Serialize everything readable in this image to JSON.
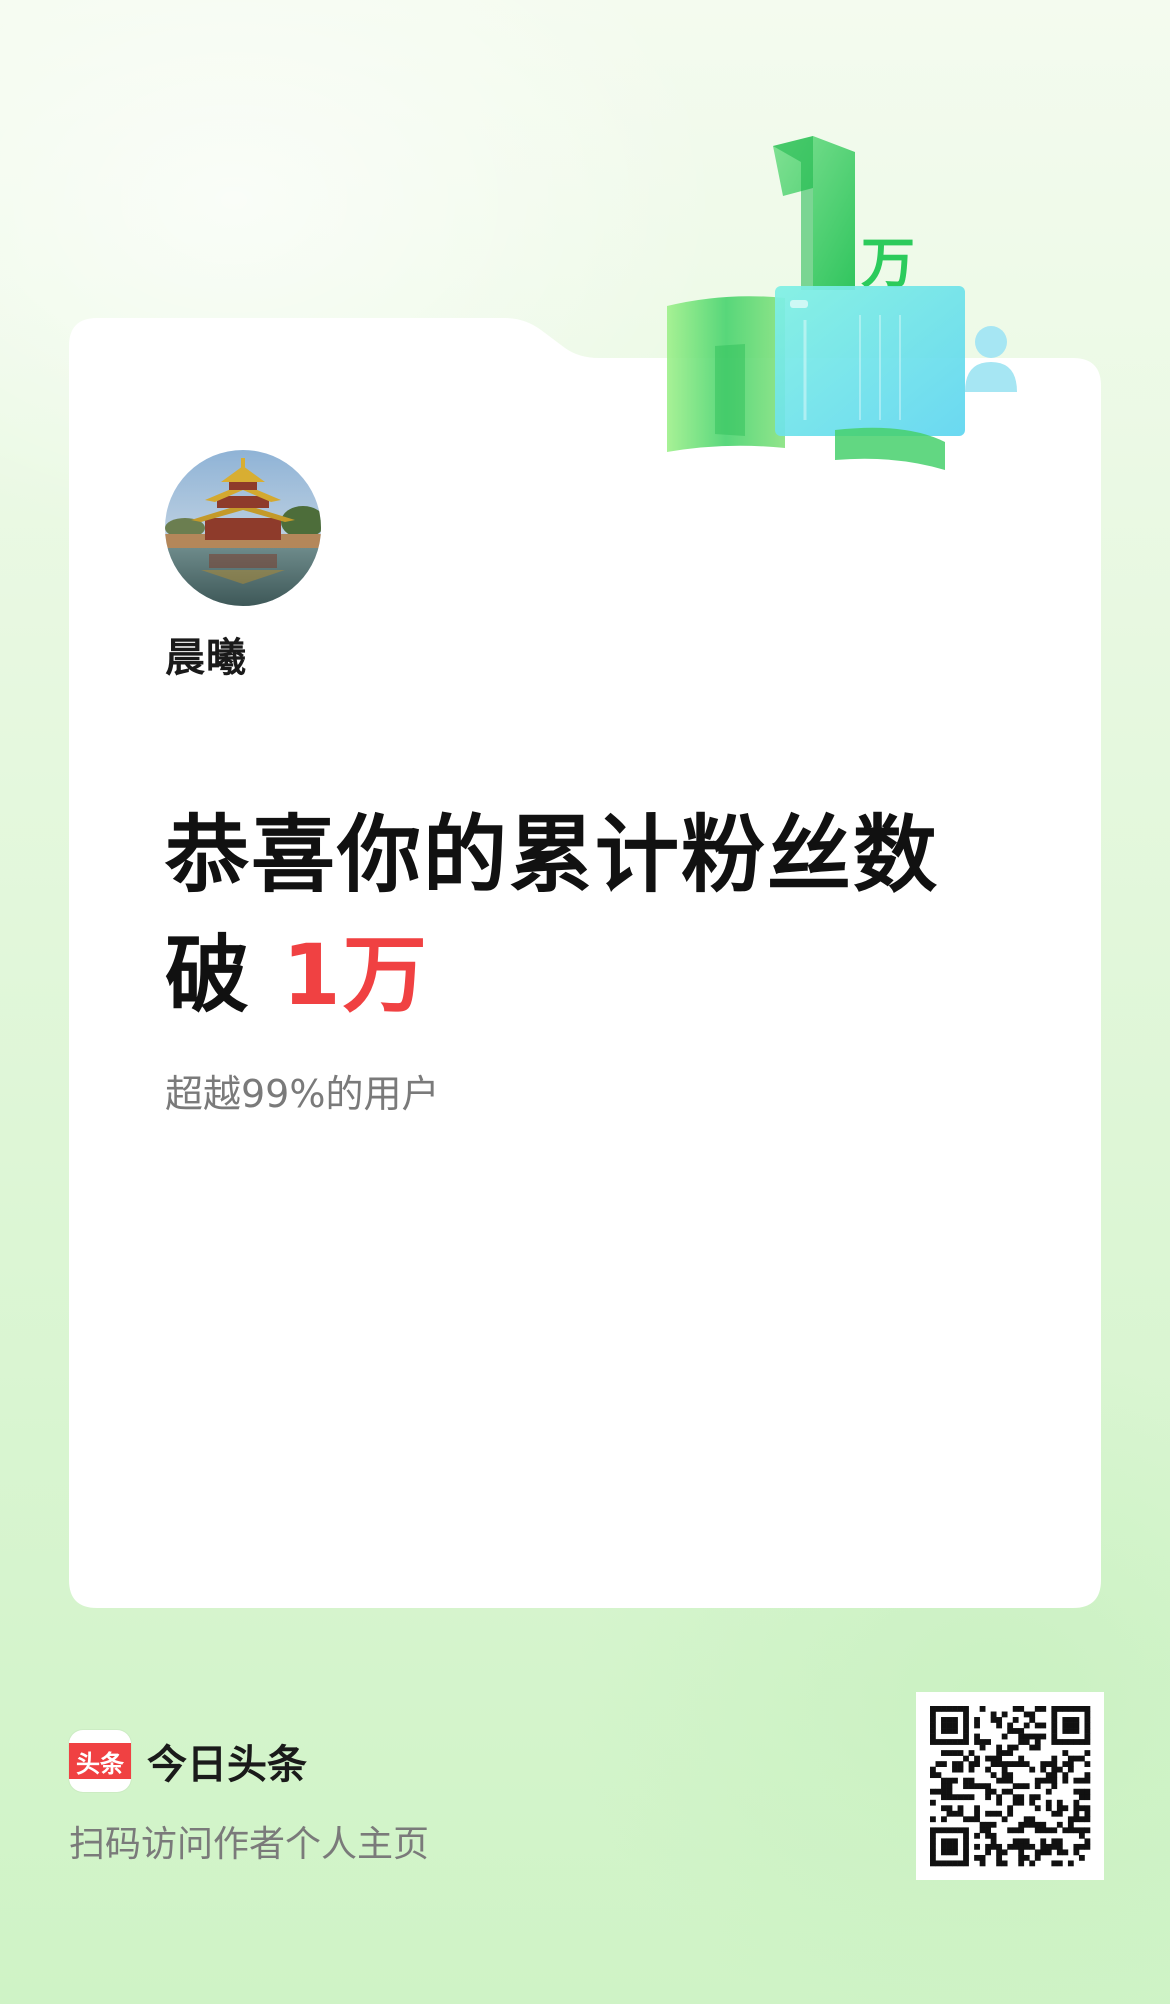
{
  "badge": {
    "number": "1",
    "unit": "万"
  },
  "profile": {
    "username": "晨曦",
    "avatar_icon": "forbidden-city-corner-tower-avatar"
  },
  "headline": {
    "line1": "恭喜你的累计粉丝数",
    "line2_prefix": "破 ",
    "line2_value": "1万"
  },
  "subtitle": "超越99%的用户",
  "footer": {
    "logo_text": "头条",
    "brand_name": "今日头条",
    "tagline": "扫码访问作者个人主页",
    "qr_icon": "qr-code-icon"
  },
  "colors": {
    "accent": "#f04142",
    "brand_green": "#3ecf6a",
    "text_primary": "#111111",
    "text_secondary": "#7a7a7a"
  }
}
